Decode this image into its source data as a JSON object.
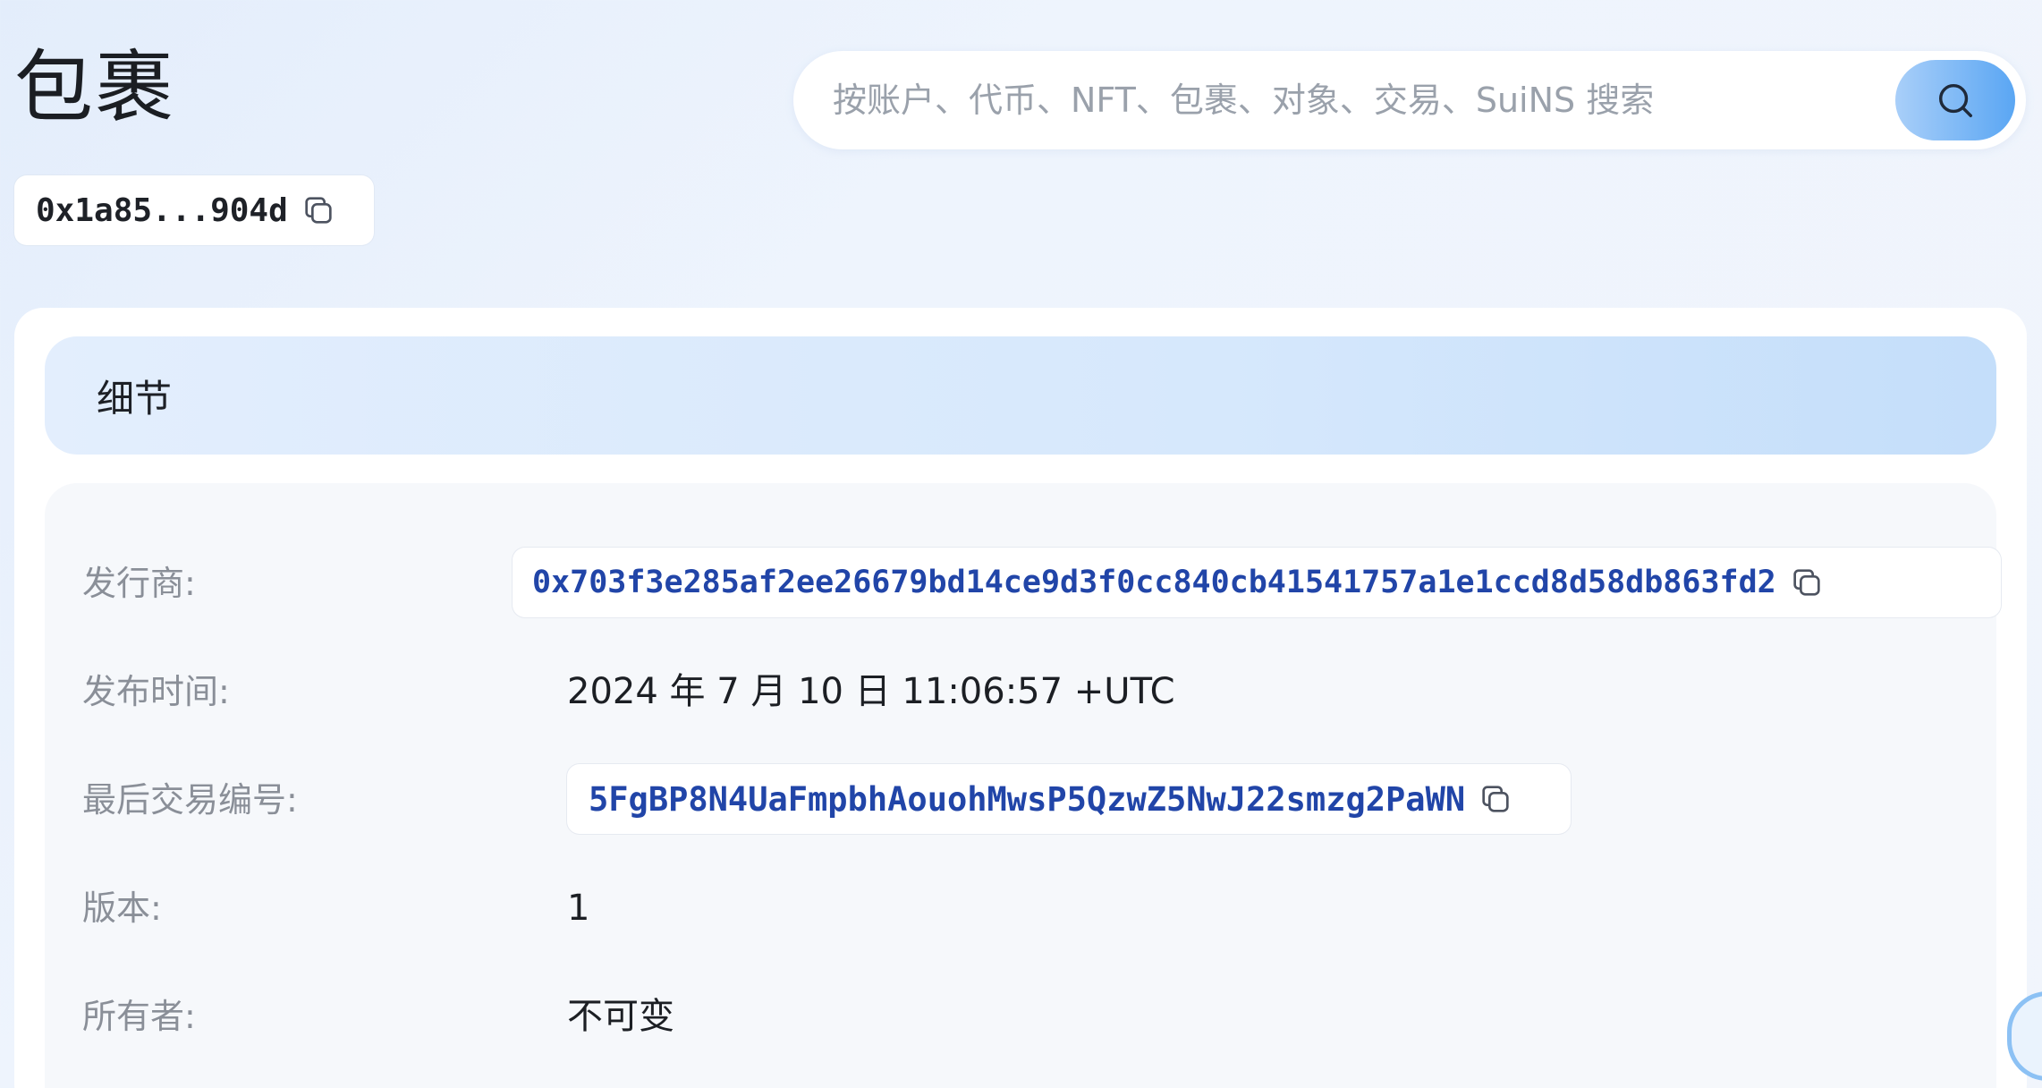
{
  "page": {
    "title": "包裹",
    "address_short": "0x1a85...904d"
  },
  "search": {
    "placeholder": "按账户、代币、NFT、包裹、对象、交易、SuiNS 搜索"
  },
  "details": {
    "header": "细节",
    "rows": [
      {
        "label": "发行商:",
        "value": "0x703f3e285af2ee26679bd14ce9d3f0cc840cb41541757a1e1ccd8d58db863fd2"
      },
      {
        "label": "发布时间:",
        "value": "2024 年 7 月 10 日 11:06:57 +UTC"
      },
      {
        "label": "最后交易编号:",
        "value": "5FgBP8N4UaFmpbhAouohMwsP5QzwZ5NwJ22smzg2PaWN"
      },
      {
        "label": "版本:",
        "value": "1"
      },
      {
        "label": "所有者:",
        "value": "不可变"
      }
    ]
  },
  "colors": {
    "link": "#2145a8",
    "label": "#8a8f98",
    "search_button_start": "#a9cff9",
    "search_button_end": "#5aa6f3"
  },
  "icons": {
    "copy": "copy-icon",
    "search": "search-icon"
  }
}
